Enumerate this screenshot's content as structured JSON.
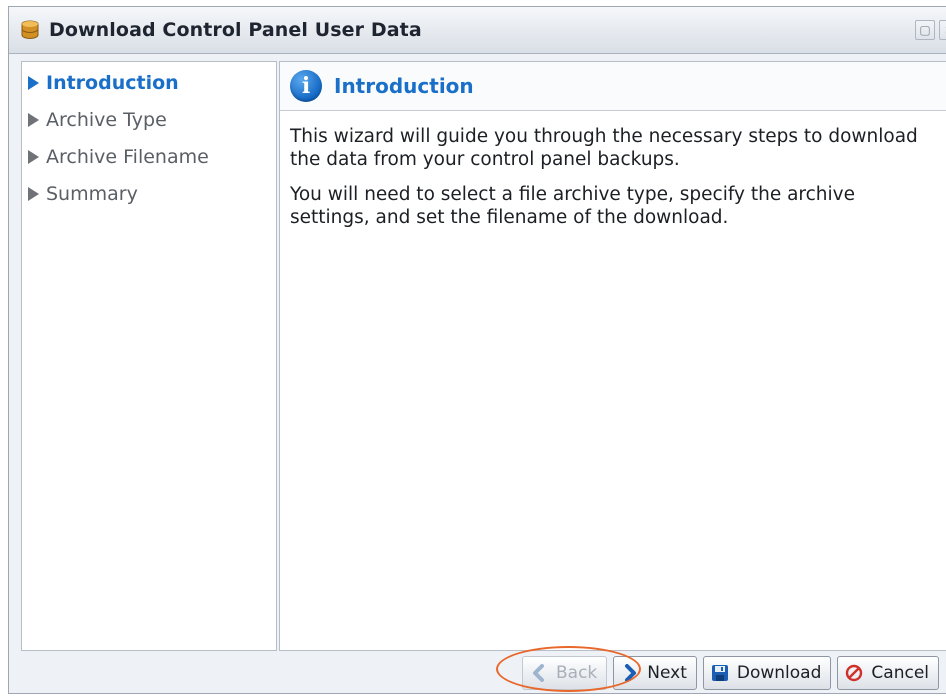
{
  "window": {
    "title": "Download Control Panel User Data",
    "controls": [
      "restore-icon",
      "close-icon"
    ]
  },
  "steps": [
    {
      "label": "Introduction",
      "active": true
    },
    {
      "label": "Archive Type",
      "active": false
    },
    {
      "label": "Archive Filename",
      "active": false
    },
    {
      "label": "Summary",
      "active": false
    }
  ],
  "panel": {
    "title": "Introduction",
    "icon": "info-icon",
    "paragraphs": [
      "This wizard will guide you through the necessary steps to download the data from your control panel backups.",
      "You will need to select a file archive type, specify the archive settings, and set the filename of the download."
    ]
  },
  "buttons": {
    "back": {
      "label": "Back",
      "enabled": false
    },
    "next": {
      "label": "Next",
      "enabled": true
    },
    "download": {
      "label": "Download",
      "enabled": true
    },
    "cancel": {
      "label": "Cancel",
      "enabled": true
    }
  },
  "colors": {
    "accent": "#1a6fc8",
    "highlight": "#e8672a",
    "cancel_icon": "#d0302a"
  }
}
